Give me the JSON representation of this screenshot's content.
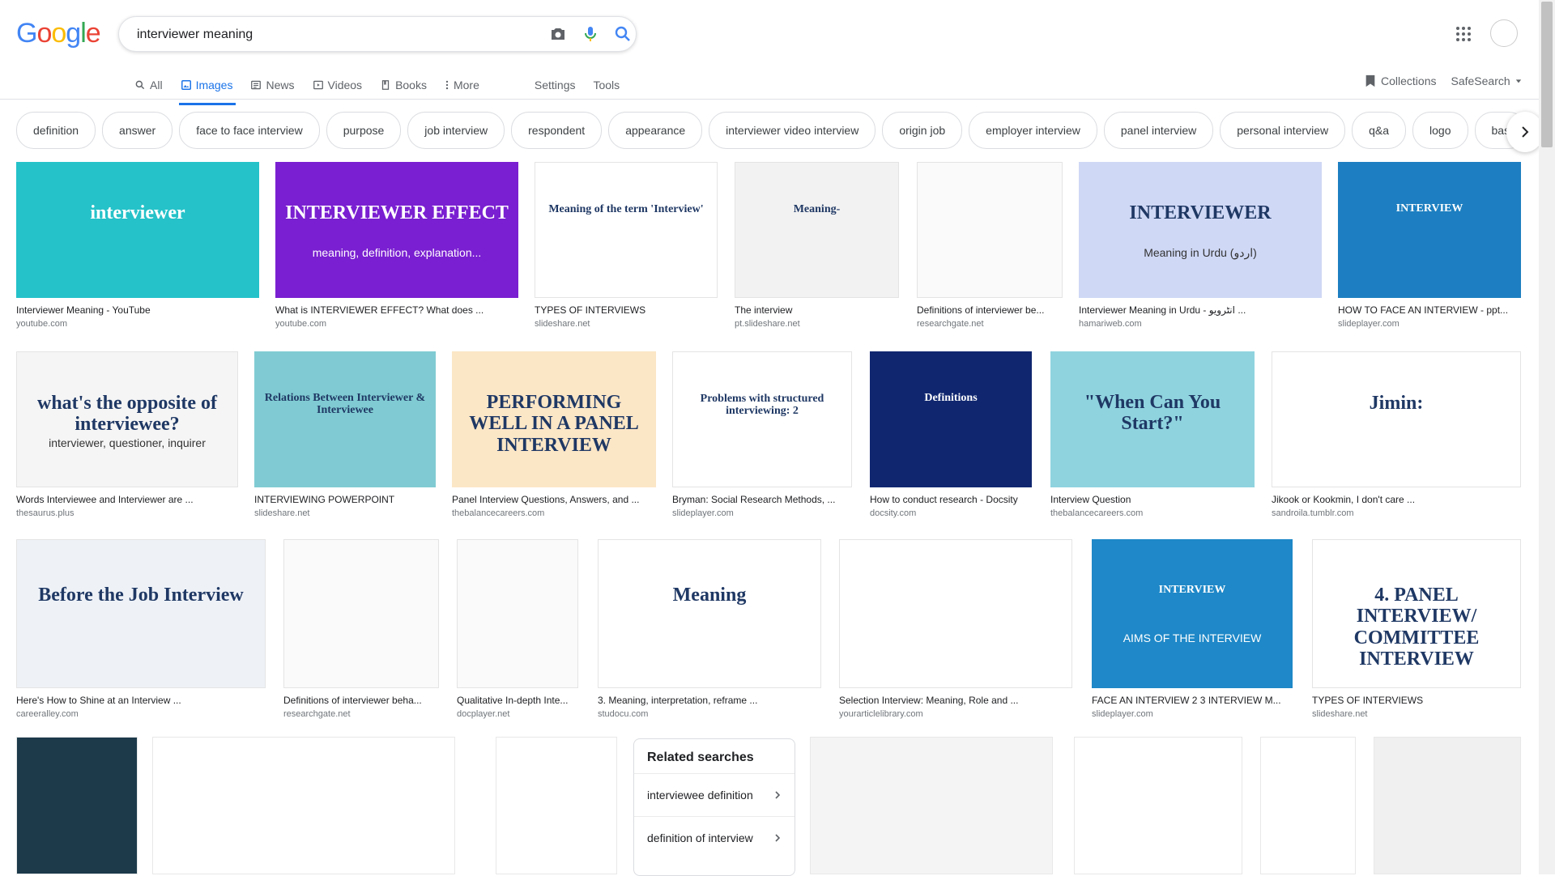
{
  "search": {
    "query": "interviewer meaning",
    "placeholder": ""
  },
  "tabs": [
    {
      "label": "All",
      "icon": "search-icon"
    },
    {
      "label": "Images",
      "icon": "image-icon",
      "active": true
    },
    {
      "label": "News",
      "icon": "news-icon"
    },
    {
      "label": "Videos",
      "icon": "video-icon"
    },
    {
      "label": "Books",
      "icon": "book-icon"
    },
    {
      "label": "More",
      "icon": "more-vert-icon"
    }
  ],
  "tools": {
    "settings": "Settings",
    "tools": "Tools",
    "collections": "Collections",
    "safesearch": "SafeSearch"
  },
  "chips": [
    "definition",
    "answer",
    "face to face interview",
    "purpose",
    "job interview",
    "respondent",
    "appearance",
    "interviewer video interview",
    "origin job",
    "employer interview",
    "panel interview",
    "personal interview",
    "q&a",
    "logo",
    "bas"
  ],
  "results": [
    {
      "title": "Interviewer Meaning - YouTube",
      "source": "youtube.com",
      "thumb_text": "interviewer"
    },
    {
      "title": "What is INTERVIEWER EFFECT? What does ...",
      "source": "youtube.com",
      "thumb_text": "INTERVIEWER EFFECT",
      "thumb_sub": "meaning, definition, explanation..."
    },
    {
      "title": "TYPES OF INTERVIEWS",
      "source": "slideshare.net",
      "thumb_text": "Meaning of the term 'Interview'"
    },
    {
      "title": "The interview",
      "source": "pt.slideshare.net",
      "thumb_text": "Meaning-"
    },
    {
      "title": "Definitions of interviewer be...",
      "source": "researchgate.net"
    },
    {
      "title": "Interviewer Meaning in Urdu - انٹرویو ...",
      "source": "hamariweb.com",
      "thumb_text": "INTERVIEWER",
      "thumb_sub": "Meaning in Urdu (اردو)"
    },
    {
      "title": "HOW TO FACE AN INTERVIEW - ppt...",
      "source": "slideplayer.com",
      "thumb_text": "INTERVIEW"
    },
    {
      "title": "Words Interviewee and Interviewer are ...",
      "source": "thesaurus.plus",
      "thumb_text": "what's the opposite of interviewee?",
      "thumb_sub": "interviewer, questioner, inquirer"
    },
    {
      "title": "INTERVIEWING POWERPOINT",
      "source": "slideshare.net",
      "thumb_text": "Relations Between Interviewer & Interviewee"
    },
    {
      "title": "Panel Interview Questions, Answers, and ...",
      "source": "thebalancecareers.com",
      "thumb_text": "PERFORMING WELL IN A PANEL INTERVIEW"
    },
    {
      "title": "Bryman: Social Research Methods, ...",
      "source": "slideplayer.com",
      "thumb_text": "Problems with structured interviewing: 2"
    },
    {
      "title": "How to conduct research - Docsity",
      "source": "docsity.com",
      "thumb_text": "Definitions"
    },
    {
      "title": "Interview Question",
      "source": "thebalancecareers.com",
      "thumb_text": "\"When Can You Start?\""
    },
    {
      "title": "Jikook or Kookmin, I don't care ...",
      "source": "sandroila.tumblr.com",
      "thumb_text": "Jimin:"
    },
    {
      "title": "Here's How to Shine at an Interview ...",
      "source": "careeralley.com",
      "thumb_text": "Before the Job Interview"
    },
    {
      "title": "Definitions of interviewer beha...",
      "source": "researchgate.net"
    },
    {
      "title": "Qualitative In-depth Inte...",
      "source": "docplayer.net"
    },
    {
      "title": "3. Meaning, interpretation, reframe ...",
      "source": "studocu.com",
      "thumb_text": "Meaning"
    },
    {
      "title": "Selection Interview: Meaning, Role and ...",
      "source": "yourarticlelibrary.com"
    },
    {
      "title": "FACE AN INTERVIEW 2 3 INTERVIEW M...",
      "source": "slideplayer.com",
      "thumb_text": "INTERVIEW",
      "thumb_sub": "AIMS OF THE INTERVIEW"
    },
    {
      "title": "TYPES OF INTERVIEWS",
      "source": "slideshare.net",
      "thumb_text": "4. PANEL INTERVIEW/ COMMITTEE INTERVIEW"
    }
  ],
  "related": {
    "title": "Related searches",
    "items": [
      "interviewee definition",
      "definition of interview"
    ]
  },
  "colors": {
    "accent": "#1a73e8",
    "text": "#202124",
    "muted": "#70757a"
  }
}
